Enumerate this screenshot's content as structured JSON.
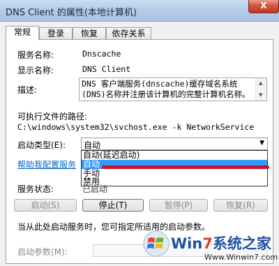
{
  "window": {
    "title": "DNS Client 的属性(本地计算机)",
    "close_label": "X"
  },
  "tabs": [
    {
      "label": "常规",
      "active": true
    },
    {
      "label": "登录",
      "active": false
    },
    {
      "label": "恢复",
      "active": false
    },
    {
      "label": "依存关系",
      "active": false
    }
  ],
  "general": {
    "service_name_label": "服务名称:",
    "service_name_value": "Dnscache",
    "display_name_label": "显示名称:",
    "display_name_value": "DNS Client",
    "description_label": "描述:",
    "description_value": "DNS 客户端服务(dnscache)缓存域名系统(DNS)名称并注册该计算机的完整计算机名称。如果",
    "exe_path_label": "可执行文件的路径:",
    "exe_path_value": "C:\\windows\\system32\\svchost.exe -k NetworkService",
    "startup_type_label": "启动类型(E):",
    "startup_type_value": "自动",
    "startup_options": [
      "自动(延迟启动)",
      "自动",
      "手动",
      "禁用"
    ],
    "help_link": "帮助我配置服务",
    "service_status_label": "服务状态:",
    "service_status_value": "已启动",
    "buttons": {
      "start": "启动(S)",
      "stop": "停止(T)",
      "pause": "暂停(P)",
      "resume": "恢复(R)"
    },
    "hint_text": "当从此处启动服务时，您可指定所适用的启动参数。",
    "start_params_label": "启动参数(M):"
  },
  "watermark": {
    "brand_prefix": "Win",
    "brand_number": "7",
    "brand_suffix": "系统之家",
    "url": "Www.Winwin7.com"
  },
  "colors": {
    "selection": "#3399ff",
    "link": "#0066cc",
    "annotation_red": "#c8112d"
  }
}
